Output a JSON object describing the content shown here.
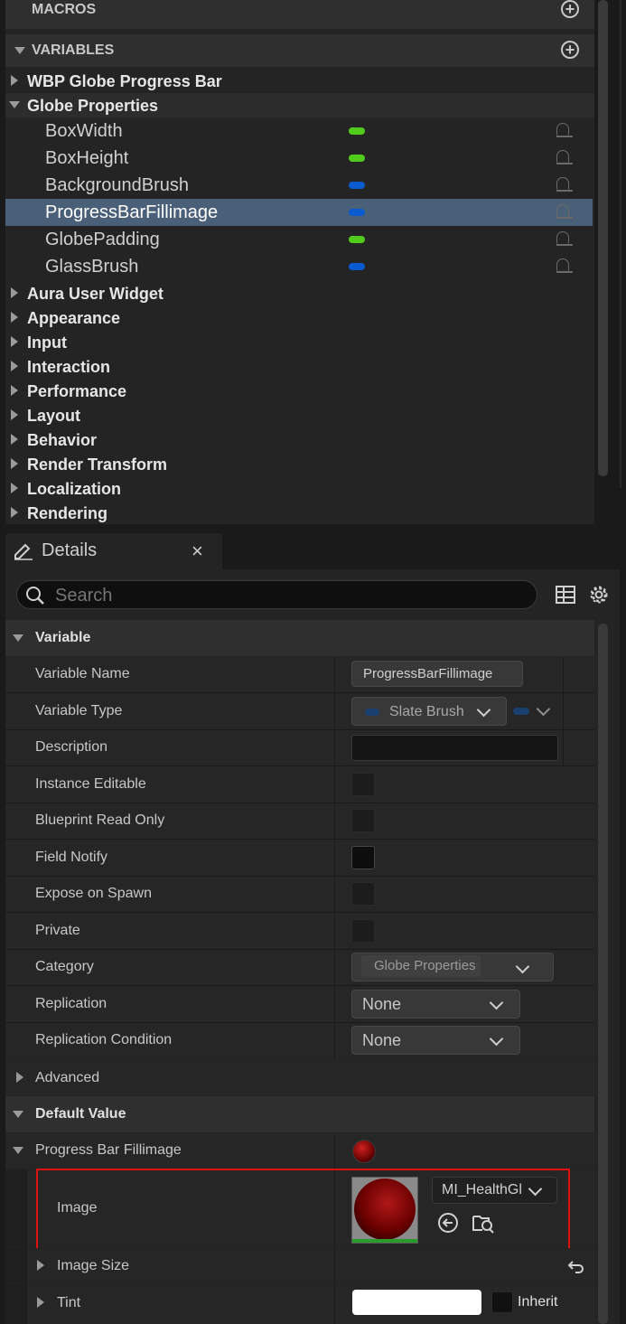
{
  "top_panel": {
    "macros_label": "MACROS",
    "variables_label": "VARIABLES",
    "categories": [
      {
        "label": "WBP Globe Progress Bar",
        "expanded": false
      },
      {
        "label": "Globe Properties",
        "expanded": true
      }
    ],
    "variables": [
      {
        "name": "BoxWidth",
        "type_color": "#52cc1a",
        "selected": false
      },
      {
        "name": "BoxHeight",
        "type_color": "#52cc1a",
        "selected": false
      },
      {
        "name": "BackgroundBrush",
        "type_color": "#0a5ad0",
        "selected": false
      },
      {
        "name": "ProgressBarFillimage",
        "type_color": "#0a5ad0",
        "selected": true
      },
      {
        "name": "GlobePadding",
        "type_color": "#52cc1a",
        "selected": false
      },
      {
        "name": "GlassBrush",
        "type_color": "#0a5ad0",
        "selected": false
      }
    ],
    "other_categories": [
      "Aura User Widget",
      "Appearance",
      "Input",
      "Interaction",
      "Performance",
      "Layout",
      "Behavior",
      "Render Transform",
      "Localization",
      "Rendering"
    ]
  },
  "details": {
    "tab_label": "Details",
    "close_glyph": "×",
    "search_placeholder": "Search",
    "variable_section": "Variable",
    "rows": {
      "variable_name_label": "Variable Name",
      "variable_name_value": "ProgressBarFillimage",
      "variable_type_label": "Variable Type",
      "variable_type_value": "Slate Brush",
      "description_label": "Description",
      "instance_editable_label": "Instance Editable",
      "blueprint_read_only_label": "Blueprint Read Only",
      "field_notify_label": "Field Notify",
      "expose_on_spawn_label": "Expose on Spawn",
      "private_label": "Private",
      "category_label": "Category",
      "category_value": "Globe Properties",
      "replication_label": "Replication",
      "replication_value": "None",
      "replication_condition_label": "Replication Condition",
      "replication_condition_value": "None",
      "advanced_label": "Advanced"
    },
    "default_value_section": "Default Value",
    "default_rows": {
      "progress_bar_fillimage_label": "Progress Bar Fillimage",
      "image_label": "Image",
      "image_asset": "MI_HealthGl",
      "image_size_label": "Image Size",
      "tint_label": "Tint",
      "tint_inherit_label": "Inherit"
    },
    "colors": {
      "highlight_box": "#e01010",
      "selection": "#4a6078",
      "tint_swatch": "#ffffff"
    }
  }
}
